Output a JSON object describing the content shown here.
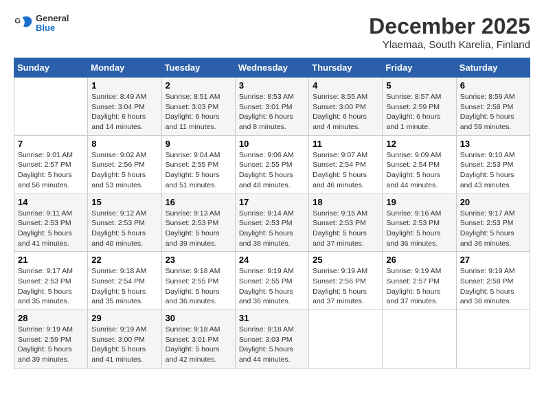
{
  "logo": {
    "text_general": "General",
    "text_blue": "Blue"
  },
  "title": "December 2025",
  "subtitle": "Ylaemaa, South Karelia, Finland",
  "weekdays": [
    "Sunday",
    "Monday",
    "Tuesday",
    "Wednesday",
    "Thursday",
    "Friday",
    "Saturday"
  ],
  "weeks": [
    [
      {
        "day": "",
        "info": ""
      },
      {
        "day": "1",
        "info": "Sunrise: 8:49 AM\nSunset: 3:04 PM\nDaylight: 6 hours\nand 14 minutes."
      },
      {
        "day": "2",
        "info": "Sunrise: 8:51 AM\nSunset: 3:03 PM\nDaylight: 6 hours\nand 11 minutes."
      },
      {
        "day": "3",
        "info": "Sunrise: 8:53 AM\nSunset: 3:01 PM\nDaylight: 6 hours\nand 8 minutes."
      },
      {
        "day": "4",
        "info": "Sunrise: 8:55 AM\nSunset: 3:00 PM\nDaylight: 6 hours\nand 4 minutes."
      },
      {
        "day": "5",
        "info": "Sunrise: 8:57 AM\nSunset: 2:59 PM\nDaylight: 6 hours\nand 1 minute."
      },
      {
        "day": "6",
        "info": "Sunrise: 8:59 AM\nSunset: 2:58 PM\nDaylight: 5 hours\nand 59 minutes."
      }
    ],
    [
      {
        "day": "7",
        "info": "Sunrise: 9:01 AM\nSunset: 2:57 PM\nDaylight: 5 hours\nand 56 minutes."
      },
      {
        "day": "8",
        "info": "Sunrise: 9:02 AM\nSunset: 2:56 PM\nDaylight: 5 hours\nand 53 minutes."
      },
      {
        "day": "9",
        "info": "Sunrise: 9:04 AM\nSunset: 2:55 PM\nDaylight: 5 hours\nand 51 minutes."
      },
      {
        "day": "10",
        "info": "Sunrise: 9:06 AM\nSunset: 2:55 PM\nDaylight: 5 hours\nand 48 minutes."
      },
      {
        "day": "11",
        "info": "Sunrise: 9:07 AM\nSunset: 2:54 PM\nDaylight: 5 hours\nand 46 minutes."
      },
      {
        "day": "12",
        "info": "Sunrise: 9:09 AM\nSunset: 2:54 PM\nDaylight: 5 hours\nand 44 minutes."
      },
      {
        "day": "13",
        "info": "Sunrise: 9:10 AM\nSunset: 2:53 PM\nDaylight: 5 hours\nand 43 minutes."
      }
    ],
    [
      {
        "day": "14",
        "info": "Sunrise: 9:11 AM\nSunset: 2:53 PM\nDaylight: 5 hours\nand 41 minutes."
      },
      {
        "day": "15",
        "info": "Sunrise: 9:12 AM\nSunset: 2:53 PM\nDaylight: 5 hours\nand 40 minutes."
      },
      {
        "day": "16",
        "info": "Sunrise: 9:13 AM\nSunset: 2:53 PM\nDaylight: 5 hours\nand 39 minutes."
      },
      {
        "day": "17",
        "info": "Sunrise: 9:14 AM\nSunset: 2:53 PM\nDaylight: 5 hours\nand 38 minutes."
      },
      {
        "day": "18",
        "info": "Sunrise: 9:15 AM\nSunset: 2:53 PM\nDaylight: 5 hours\nand 37 minutes."
      },
      {
        "day": "19",
        "info": "Sunrise: 9:16 AM\nSunset: 2:53 PM\nDaylight: 5 hours\nand 36 minutes."
      },
      {
        "day": "20",
        "info": "Sunrise: 9:17 AM\nSunset: 2:53 PM\nDaylight: 5 hours\nand 36 minutes."
      }
    ],
    [
      {
        "day": "21",
        "info": "Sunrise: 9:17 AM\nSunset: 2:53 PM\nDaylight: 5 hours\nand 35 minutes."
      },
      {
        "day": "22",
        "info": "Sunrise: 9:18 AM\nSunset: 2:54 PM\nDaylight: 5 hours\nand 35 minutes."
      },
      {
        "day": "23",
        "info": "Sunrise: 9:18 AM\nSunset: 2:55 PM\nDaylight: 5 hours\nand 36 minutes."
      },
      {
        "day": "24",
        "info": "Sunrise: 9:19 AM\nSunset: 2:55 PM\nDaylight: 5 hours\nand 36 minutes."
      },
      {
        "day": "25",
        "info": "Sunrise: 9:19 AM\nSunset: 2:56 PM\nDaylight: 5 hours\nand 37 minutes."
      },
      {
        "day": "26",
        "info": "Sunrise: 9:19 AM\nSunset: 2:57 PM\nDaylight: 5 hours\nand 37 minutes."
      },
      {
        "day": "27",
        "info": "Sunrise: 9:19 AM\nSunset: 2:58 PM\nDaylight: 5 hours\nand 38 minutes."
      }
    ],
    [
      {
        "day": "28",
        "info": "Sunrise: 9:19 AM\nSunset: 2:59 PM\nDaylight: 5 hours\nand 39 minutes."
      },
      {
        "day": "29",
        "info": "Sunrise: 9:19 AM\nSunset: 3:00 PM\nDaylight: 5 hours\nand 41 minutes."
      },
      {
        "day": "30",
        "info": "Sunrise: 9:18 AM\nSunset: 3:01 PM\nDaylight: 5 hours\nand 42 minutes."
      },
      {
        "day": "31",
        "info": "Sunrise: 9:18 AM\nSunset: 3:03 PM\nDaylight: 5 hours\nand 44 minutes."
      },
      {
        "day": "",
        "info": ""
      },
      {
        "day": "",
        "info": ""
      },
      {
        "day": "",
        "info": ""
      }
    ]
  ]
}
